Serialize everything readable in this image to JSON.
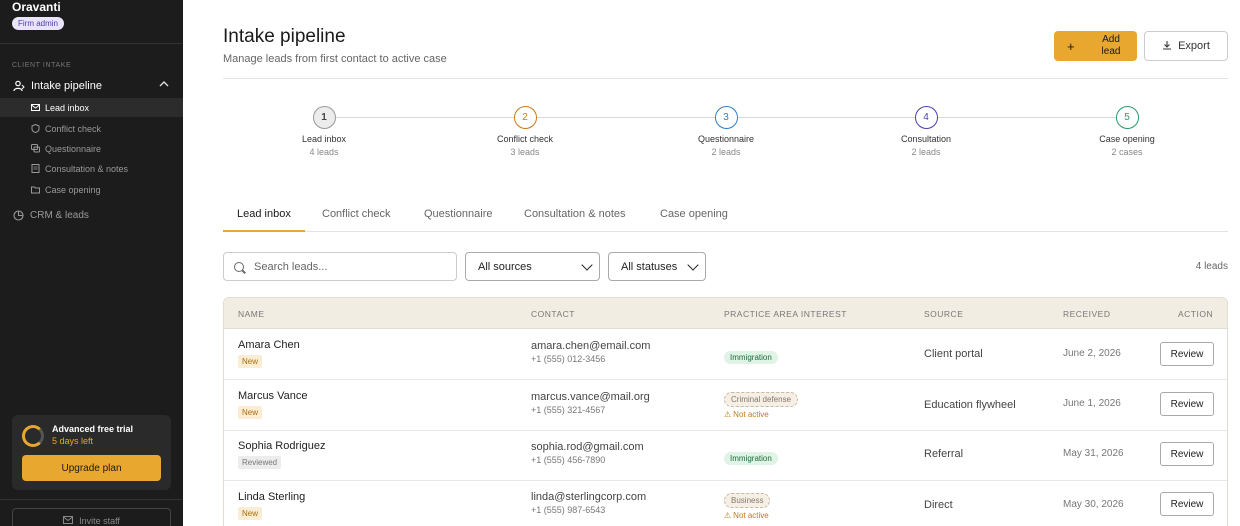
{
  "sidebar": {
    "brand": "Oravanti",
    "role_badge": "Firm admin",
    "section_label": "CLIENT INTAKE",
    "group": {
      "label": "Intake pipeline",
      "expanded": true
    },
    "sub_items": [
      {
        "label": "Lead inbox",
        "active": true
      },
      {
        "label": "Conflict check",
        "active": false
      },
      {
        "label": "Questionnaire",
        "active": false
      },
      {
        "label": "Consultation & notes",
        "active": false
      },
      {
        "label": "Case opening",
        "active": false
      }
    ],
    "crm_label": "CRM & leads",
    "trial": {
      "title": "Advanced free trial",
      "remaining": "5 days left",
      "upgrade_label": "Upgrade plan"
    },
    "invite_label": "Invite staff"
  },
  "header": {
    "title": "Intake pipeline",
    "subtitle": "Manage leads from first contact to active case",
    "add_label": "Add lead",
    "export_label": "Export"
  },
  "stepper": [
    {
      "number": "1",
      "name": "Lead inbox",
      "count": "4 leads",
      "color": "#777777"
    },
    {
      "number": "2",
      "name": "Conflict check",
      "count": "3 leads",
      "color": "#c77a16"
    },
    {
      "number": "3",
      "name": "Questionnaire",
      "count": "2 leads",
      "color": "#2d7fc9"
    },
    {
      "number": "4",
      "name": "Consultation",
      "count": "2 leads",
      "color": "#4b3fb0"
    },
    {
      "number": "5",
      "name": "Case opening",
      "count": "2 cases",
      "color": "#2b9a6a"
    }
  ],
  "tabs": [
    {
      "label": "Lead inbox",
      "active": true
    },
    {
      "label": "Conflict check",
      "active": false
    },
    {
      "label": "Questionnaire",
      "active": false
    },
    {
      "label": "Consultation & notes",
      "active": false
    },
    {
      "label": "Case opening",
      "active": false
    }
  ],
  "filters": {
    "search_placeholder": "Search leads...",
    "source_selected": "All sources",
    "status_selected": "All statuses",
    "count_label": "4 leads"
  },
  "table": {
    "columns": [
      "NAME",
      "CONTACT",
      "PRACTICE AREA INTEREST",
      "SOURCE",
      "RECEIVED",
      "ACTION"
    ],
    "rows": [
      {
        "name": "Amara Chen",
        "status": "New",
        "email": "amara.chen@email.com",
        "phone": "+1 (555) 012-3456",
        "practice": "Immigration",
        "practice_active": true,
        "practice_note": "",
        "source": "Client portal",
        "received": "June 2, 2026",
        "action": "Review"
      },
      {
        "name": "Marcus Vance",
        "status": "New",
        "email": "marcus.vance@mail.org",
        "phone": "+1 (555) 321-4567",
        "practice": "Criminal defense",
        "practice_active": false,
        "practice_note": "Not active",
        "source": "Education flywheel",
        "received": "June 1, 2026",
        "action": "Review"
      },
      {
        "name": "Sophia Rodriguez",
        "status": "Reviewed",
        "email": "sophia.rod@gmail.com",
        "phone": "+1 (555) 456-7890",
        "practice": "Immigration",
        "practice_active": true,
        "practice_note": "",
        "source": "Referral",
        "received": "May 31, 2026",
        "action": "Review"
      },
      {
        "name": "Linda Sterling",
        "status": "New",
        "email": "linda@sterlingcorp.com",
        "phone": "+1 (555) 987-6543",
        "practice": "Business",
        "practice_active": false,
        "practice_note": "Not active",
        "source": "Direct",
        "received": "May 30, 2026",
        "action": "Review"
      }
    ]
  },
  "colors": {
    "accent": "#e8a72e",
    "sidebar_bg": "#1c1c1c"
  }
}
